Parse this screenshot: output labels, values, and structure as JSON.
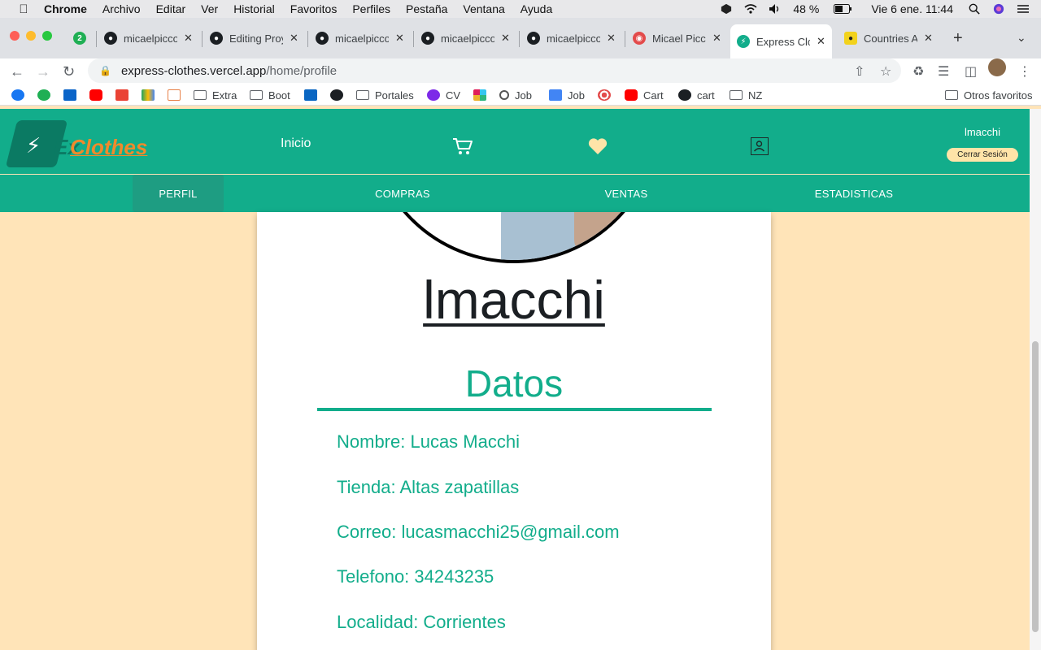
{
  "menubar": {
    "app": "Chrome",
    "items": [
      "Archivo",
      "Editar",
      "Ver",
      "Historial",
      "Favoritos",
      "Perfiles",
      "Pestaña",
      "Ventana",
      "Ayuda"
    ],
    "battery": "48 %",
    "clock": "Vie 6 ene.  11:44"
  },
  "tabs": [
    {
      "title": "2",
      "favicon": "badge-icon"
    },
    {
      "title": "micaelpicco",
      "favicon": "github-icon"
    },
    {
      "title": "Editing Proy",
      "favicon": "github-icon"
    },
    {
      "title": "micaelpicco",
      "favicon": "github-icon"
    },
    {
      "title": "micaelpicco",
      "favicon": "github-icon"
    },
    {
      "title": "micaelpicco",
      "favicon": "github-icon"
    },
    {
      "title": "Micael Picc",
      "favicon": "target-icon"
    },
    {
      "title": "Express Clo",
      "favicon": "expressclothes-icon",
      "active": true
    },
    {
      "title": "Countries A",
      "favicon": "countries-icon"
    }
  ],
  "address": {
    "host": "express-clothes.vercel.app",
    "path": "/home/profile"
  },
  "bookmarks": [
    {
      "label": "",
      "icon": "facebook-icon"
    },
    {
      "label": "",
      "icon": "badge-icon"
    },
    {
      "label": "",
      "icon": "outlook-icon"
    },
    {
      "label": "",
      "icon": "youtube-icon"
    },
    {
      "label": "",
      "icon": "gmail-icon"
    },
    {
      "label": "",
      "icon": "drive-icon"
    },
    {
      "label": "",
      "icon": "cube-icon"
    },
    {
      "label": "Extra",
      "icon": "folder-icon"
    },
    {
      "label": "Boot",
      "icon": "folder-icon"
    },
    {
      "label": "",
      "icon": "linkedin-icon"
    },
    {
      "label": "",
      "icon": "github-icon"
    },
    {
      "label": "Portales",
      "icon": "folder-icon"
    },
    {
      "label": "CV",
      "icon": "canva-icon"
    },
    {
      "label": "",
      "icon": "slack-icon"
    },
    {
      "label": "Job",
      "icon": "search-icon"
    },
    {
      "label": "Job",
      "icon": "docs-icon"
    },
    {
      "label": "",
      "icon": "target-icon"
    },
    {
      "label": "Cart",
      "icon": "youtube-icon"
    },
    {
      "label": "cart",
      "icon": "github-icon"
    },
    {
      "label": "NZ",
      "icon": "folder-icon"
    },
    {
      "label": "Otros favoritos",
      "icon": "folder-icon"
    }
  ],
  "site": {
    "logo_ex": "Ex",
    "logo_clothes": "Clothes",
    "nav_home": "Inicio",
    "username": "lmacchi",
    "logout": "Cerrar Sesión",
    "subnav": [
      "PERFIL",
      "COMPRAS",
      "VENTAS",
      "ESTADISTICAS"
    ],
    "accent": "#12ad8b",
    "background": "#ffe4b8"
  },
  "profile": {
    "display_name": "lmacchi",
    "section_title": "Datos",
    "fields": [
      "Nombre: Lucas Macchi",
      "Tienda: Altas zapatillas",
      "Correo: lucasmacchi25@gmail.com",
      "Telefono: 34243235",
      "Localidad: Corrientes"
    ]
  }
}
